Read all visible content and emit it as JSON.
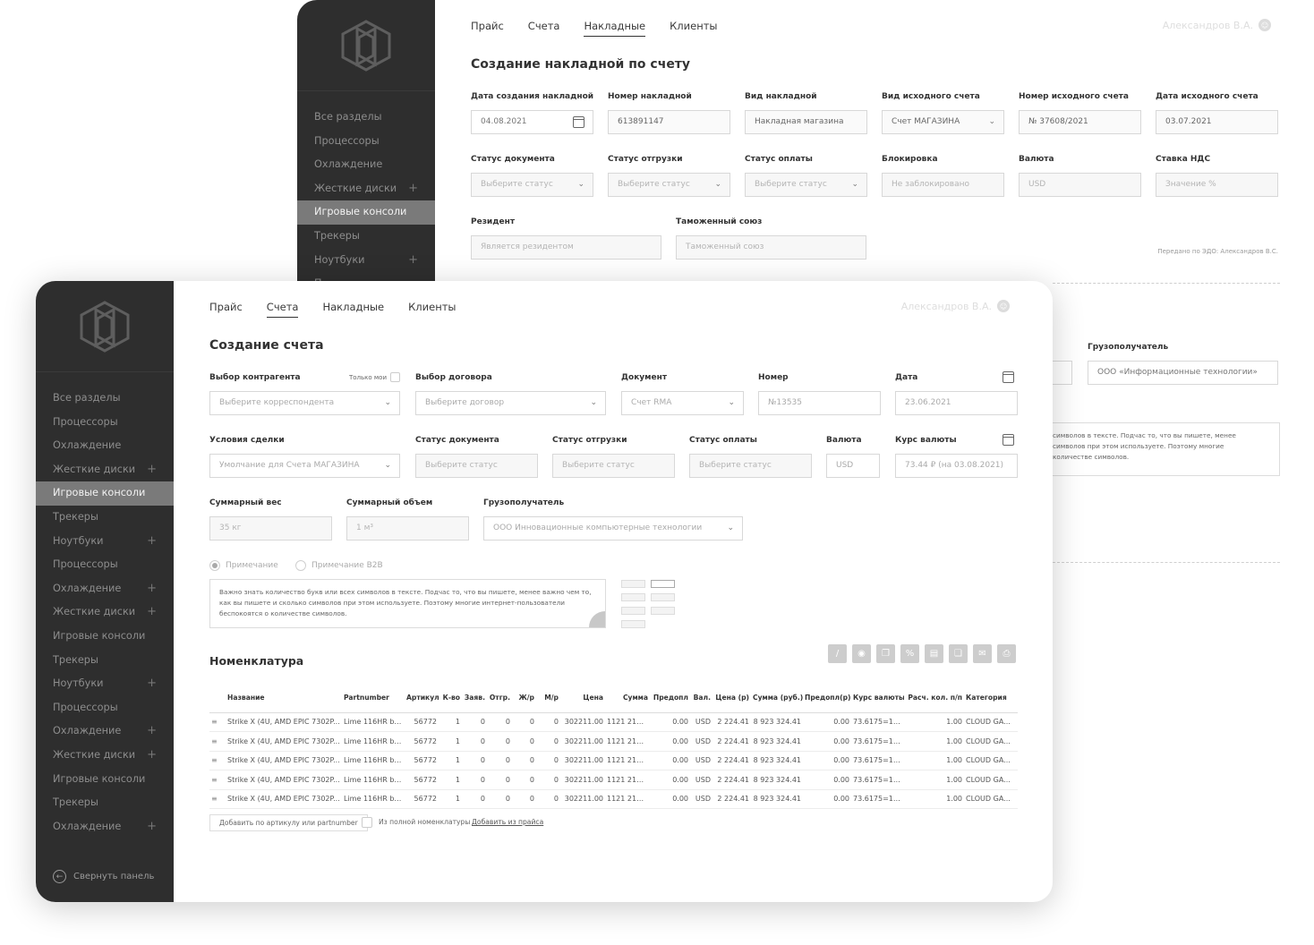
{
  "back": {
    "nav": [
      "Все разделы",
      "Процессоры",
      "Охлаждение",
      "Жесткие диски",
      "Игровые консоли",
      "Трекеры",
      "Ноутбуки",
      "П"
    ],
    "tabs": [
      "Прайс",
      "Счета",
      "Накладные",
      "Клиенты"
    ],
    "user": "Александров В.А.",
    "title": "Создание накладной по счету",
    "row1": {
      "labels": [
        "Дата создания накладной",
        "Номер накладной",
        "Вид накладной",
        "Вид исходного счета",
        "Номер исходного счета",
        "Дата исходного счета"
      ],
      "values": [
        "04.08.2021",
        "613891147",
        "Накладная магазина",
        "Счет МАГАЗИНА",
        "№ 37608/2021",
        "03.07.2021"
      ]
    },
    "row2": {
      "labels": [
        "Статус документа",
        "Статус отгрузки",
        "Статус оплаты",
        "Блокировка",
        "Валюта",
        "Ставка НДС"
      ],
      "values": [
        "Выберите статус",
        "Выберите статус",
        "Выберите статус",
        "Не заблокировано",
        "USD",
        "Значение %"
      ]
    },
    "row3": {
      "labels": [
        "Резидент",
        "Таможенный союз"
      ],
      "values": [
        "Является резидентом",
        "Таможенный союз"
      ]
    },
    "sent_note": "Передано по ЭДО: Александров В.С.",
    "consignee_label": "Грузополучатель",
    "consignee_value": "ООО «Информационные технологии»",
    "note_lines": [
      "символов в тексте. Подчас то, что вы пишете, менее",
      "символов при этом используете. Поэтому многие",
      "количестве символов."
    ]
  },
  "front": {
    "nav": [
      "Все разделы",
      "Процессоры",
      "Охлаждение",
      "Жесткие диски",
      "Игровые консоли",
      "Трекеры",
      "Ноутбуки",
      "Процессоры",
      "Охлаждение",
      "Жесткие диски",
      "Игровые консоли",
      "Трекеры",
      "Ноутбуки",
      "Процессоры",
      "Охлаждение",
      "Жесткие диски",
      "Игровые консоли",
      "Трекеры",
      "Охлаждение"
    ],
    "collapse": "Свернуть панель",
    "tabs": [
      "Прайс",
      "Счета",
      "Накладные",
      "Клиенты"
    ],
    "user": "Александров В.А.",
    "title": "Создание счета",
    "only_mine": "Только мои",
    "row1": {
      "labels": [
        "Выбор контрагента",
        "Выбор договора",
        "Документ",
        "Номер",
        "Дата"
      ],
      "values": [
        "Выберите корреспондента",
        "Выберите договор",
        "Счет RMA",
        "№13535",
        "23.06.2021"
      ]
    },
    "row2": {
      "labels": [
        "Условия сделки",
        "Статус документа",
        "Статус отгрузки",
        "Статус оплаты",
        "Валюта",
        "Курс валюты"
      ],
      "values": [
        "Умолчание для Счета МАГАЗИНА",
        "Выберите статус",
        "Выберите статус",
        "Выберите статус",
        "USD",
        "73.44 ₽ (на 03.08.2021)"
      ]
    },
    "row3": {
      "labels": [
        "Суммарный вес",
        "Суммарный объем",
        "Грузополучатель"
      ],
      "values": [
        "35 кг",
        "1 м³",
        "ООО Инновационные компьютерные технологии"
      ]
    },
    "radio1": "Примечание",
    "radio2": "Примечание B2B",
    "note": "Важно знать количество букв или всех символов в тексте. Подчас то, что вы пишете, менее важно чем то, как вы пишете и сколько символов при этом используете. Поэтому многие интернет-пользователи беспокоятся о количестве символов.",
    "nom_title": "Номенклатура",
    "columns": [
      "Название",
      "Partnumber",
      "Артикул",
      "К-во",
      "Заяв.",
      "Отгр.",
      "Ж/р",
      "М/р",
      "Цена",
      "Сумма",
      "Предопл",
      "Вал.",
      "Цена (р)",
      "Сумма (руб.)",
      "Предопл(р)",
      "Курс валюты",
      "Расч. кол. п/п",
      "Категория"
    ],
    "rows": [
      [
        "Strike X (4U, AMD EPIC 7302P...",
        "Lime 116HR black",
        "56772",
        "1",
        "0",
        "0",
        "0",
        "0",
        "302211.00",
        "1121 212.00",
        "0.00",
        "USD",
        "2 224.41",
        "8 923 324.41",
        "0.00",
        "73.6175=1 USD",
        "1.00",
        "CLOUD GA..."
      ],
      [
        "Strike X (4U, AMD EPIC 7302P...",
        "Lime 116HR black",
        "56772",
        "1",
        "0",
        "0",
        "0",
        "0",
        "302211.00",
        "1121 212.00",
        "0.00",
        "USD",
        "2 224.41",
        "8 923 324.41",
        "0.00",
        "73.6175=1 USD",
        "1.00",
        "CLOUD GA..."
      ],
      [
        "Strike X (4U, AMD EPIC 7302P...",
        "Lime 116HR black",
        "56772",
        "1",
        "0",
        "0",
        "0",
        "0",
        "302211.00",
        "1121 212.00",
        "0.00",
        "USD",
        "2 224.41",
        "8 923 324.41",
        "0.00",
        "73.6175=1 USD",
        "1.00",
        "CLOUD GA..."
      ],
      [
        "Strike X (4U, AMD EPIC 7302P...",
        "Lime 116HR black",
        "56772",
        "1",
        "0",
        "0",
        "0",
        "0",
        "302211.00",
        "1121 212.00",
        "0.00",
        "USD",
        "2 224.41",
        "8 923 324.41",
        "0.00",
        "73.6175=1 USD",
        "1.00",
        "CLOUD GA..."
      ],
      [
        "Strike X (4U, AMD EPIC 7302P...",
        "Lime 116HR black",
        "56772",
        "1",
        "0",
        "0",
        "0",
        "0",
        "302211.00",
        "1121 212.00",
        "0.00",
        "USD",
        "2 224.41",
        "8 923 324.41",
        "0.00",
        "73.6175=1 USD",
        "1.00",
        "CLOUD GA..."
      ]
    ],
    "add_by_article": "Добавить по артикулу или partnumber",
    "from_full": "Из полной номенклатуры",
    "add_from_price": "Добавить из прайса"
  },
  "icons": [
    "edit-icon",
    "eye-icon",
    "copy-icon",
    "percent-icon",
    "export-icon",
    "duplicate-icon",
    "mail-icon",
    "print-icon"
  ]
}
